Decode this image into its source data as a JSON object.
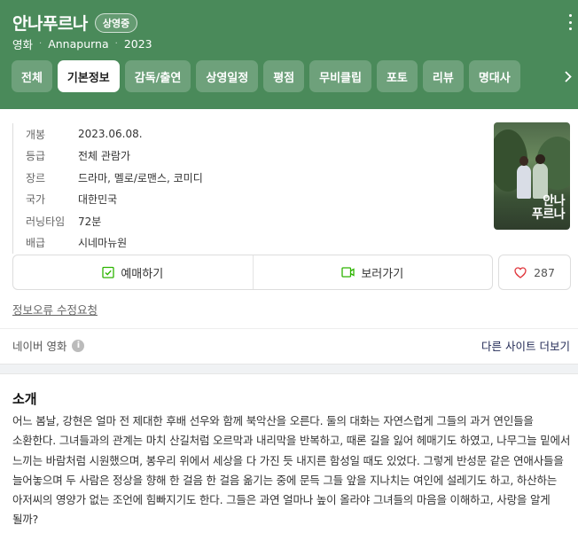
{
  "header": {
    "title": "안나푸르나",
    "status_badge": "상영중",
    "category": "영화",
    "original_title": "Annapurna",
    "year": "2023"
  },
  "tabs": [
    {
      "label": "전체",
      "active": false
    },
    {
      "label": "기본정보",
      "active": true
    },
    {
      "label": "감독/출연",
      "active": false
    },
    {
      "label": "상영일정",
      "active": false
    },
    {
      "label": "평점",
      "active": false
    },
    {
      "label": "무비클립",
      "active": false
    },
    {
      "label": "포토",
      "active": false
    },
    {
      "label": "리뷰",
      "active": false
    },
    {
      "label": "명대사",
      "active": false
    }
  ],
  "info": [
    {
      "label": "개봉",
      "value": "2023.06.08."
    },
    {
      "label": "등급",
      "value": "전체 관람가"
    },
    {
      "label": "장르",
      "value": "드라마, 멜로/로맨스, 코미디"
    },
    {
      "label": "국가",
      "value": "대한민국"
    },
    {
      "label": "러닝타임",
      "value": "72분"
    },
    {
      "label": "배급",
      "value": "시네마뉴원"
    }
  ],
  "poster": {
    "title": "안나\n푸르나"
  },
  "actions": {
    "reserve_label": "예매하기",
    "watch_label": "보러가기",
    "like_count": "287"
  },
  "report_link": "정보오류 수정요청",
  "source": {
    "label": "네이버 영화",
    "more_sites": "다른 사이트 더보기"
  },
  "intro": {
    "title": "소개",
    "text": "어느 봄날, 강현은 얼마 전 제대한 후배 선우와 함께 북악산을 오른다. 둘의 대화는 자연스럽게 그들의 과거 연인들을 소환한다. 그녀들과의 관계는 마치 산길처럼 오르막과 내리막을 반복하고, 때론 길을 잃어 헤매기도 하였고, 나무그늘 밑에서 느끼는 바람처럼 시원했으며, 봉우리 위에서 세상을 다 가진 듯 내지른 함성일 때도 있었다. 그렇게 반성문 같은 연애사들을 늘어놓으며 두 사람은 정상을 향해 한 걸음 한 걸음 옮기는 중에 문득 그들 앞을 지나치는 여인에 설레기도 하고, 하산하는 아저씨의 영양가 없는 조언에 힘빠지기도 한다. 그들은 과연 얼마나 높이 올라야 그녀들의 마음을 이해하고, 사랑을 알게 될까?"
  },
  "colors": {
    "header_bg": "#4a8a5a",
    "reserve_icon": "#2db400",
    "watch_icon": "#2db400",
    "heart": "#e0383e"
  }
}
